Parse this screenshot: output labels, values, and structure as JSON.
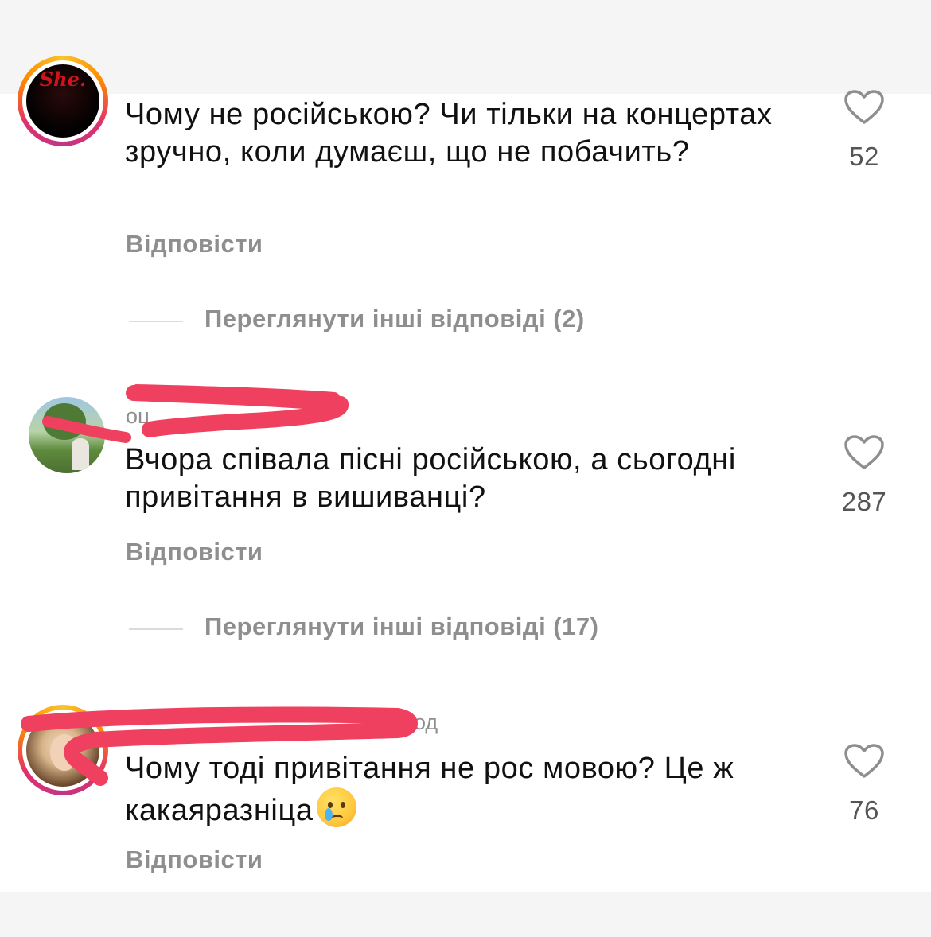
{
  "comments": [
    {
      "username": "",
      "text": "Чому не російською? Чи тільки на концертах зручно, коли думаєш, що не побачить?",
      "likes": "52",
      "reply_label": "Відповісти",
      "view_replies": "Переглянути інші відповіді (2)",
      "avatar_logo": "She."
    },
    {
      "username": "оц",
      "text": "Вчора співала пісні російською, а сьогодні привітання в вишиванці?",
      "likes": "287",
      "reply_label": "Відповісти",
      "view_replies": "Переглянути інші відповіді (17)"
    },
    {
      "username": "од",
      "text": "Чому тоді привітання не рос мовою? Це ж какаяразніца",
      "likes": "76",
      "reply_label": "Відповісти"
    }
  ],
  "icons": {
    "like": "heart-outline-icon",
    "emoji": "crying-face-emoji"
  },
  "colors": {
    "redaction": "#f0405f",
    "story_ring": "#e1306c",
    "muted_text": "#8e8e8e"
  }
}
